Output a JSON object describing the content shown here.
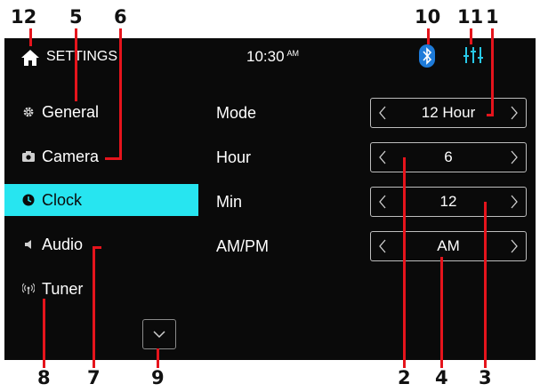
{
  "header": {
    "title": "SETTINGS",
    "time": "10:30",
    "ampm": "AM",
    "icons": [
      "home-icon",
      "bluetooth-icon",
      "equalizer-icon"
    ]
  },
  "sidebar": {
    "items": [
      {
        "label": "General",
        "icon": "gear-icon"
      },
      {
        "label": "Camera",
        "icon": "camera-icon"
      },
      {
        "label": "Clock",
        "icon": "clock-icon",
        "active": true
      },
      {
        "label": "Audio",
        "icon": "speaker-icon"
      },
      {
        "label": "Tuner",
        "icon": "antenna-icon"
      }
    ],
    "scroll_icon": "chevron-down-icon"
  },
  "settings": [
    {
      "label": "Mode",
      "value": "12 Hour"
    },
    {
      "label": "Hour",
      "value": "6"
    },
    {
      "label": "Min",
      "value": "12"
    },
    {
      "label": "AM/PM",
      "value": "AM"
    }
  ],
  "callouts": [
    "12",
    "5",
    "6",
    "10",
    "11",
    "1",
    "8",
    "7",
    "9",
    "2",
    "4",
    "3"
  ],
  "colors": {
    "screen_bg": "#0a0a0a",
    "active_item": "#27e5f0",
    "bluetooth": "#1e7bd9",
    "equalizer": "#27c9e8",
    "callout_line": "#e5141c"
  }
}
